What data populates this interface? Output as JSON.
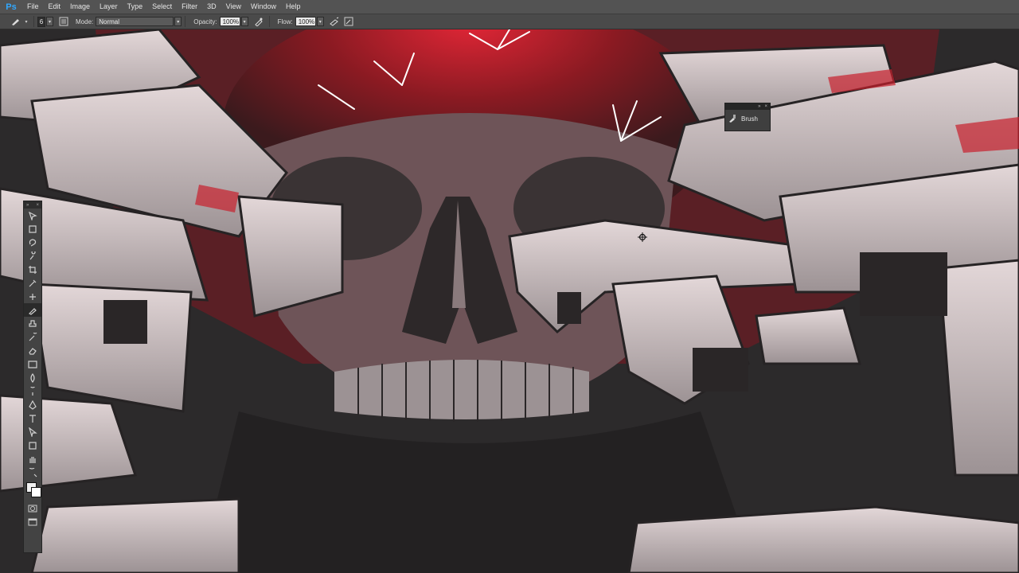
{
  "app": {
    "logo": "Ps"
  },
  "menu": [
    "File",
    "Edit",
    "Image",
    "Layer",
    "Type",
    "Select",
    "Filter",
    "3D",
    "View",
    "Window",
    "Help"
  ],
  "options": {
    "brush_size": "6",
    "mode_label": "Mode:",
    "mode_value": "Normal",
    "opacity_label": "Opacity:",
    "opacity_value": "100%",
    "flow_label": "Flow:",
    "flow_value": "100%"
  },
  "brush_panel": {
    "label": "Brush"
  },
  "tools": [
    "move-tool-icon",
    "marquee-tool-icon",
    "lasso-tool-icon",
    "quick-select-tool-icon",
    "crop-tool-icon",
    "eyedropper-tool-icon",
    "healing-brush-tool-icon",
    "brush-tool-icon",
    "clone-stamp-tool-icon",
    "history-brush-tool-icon",
    "eraser-tool-icon",
    "gradient-tool-icon",
    "blur-tool-icon",
    "dodge-tool-icon",
    "pen-tool-icon",
    "type-tool-icon",
    "path-select-tool-icon",
    "shape-tool-icon",
    "hand-tool-icon",
    "zoom-tool-icon"
  ],
  "colors": {
    "foreground": "#f2f2f2",
    "background": "#ffffff",
    "accent": "#c8202c"
  }
}
